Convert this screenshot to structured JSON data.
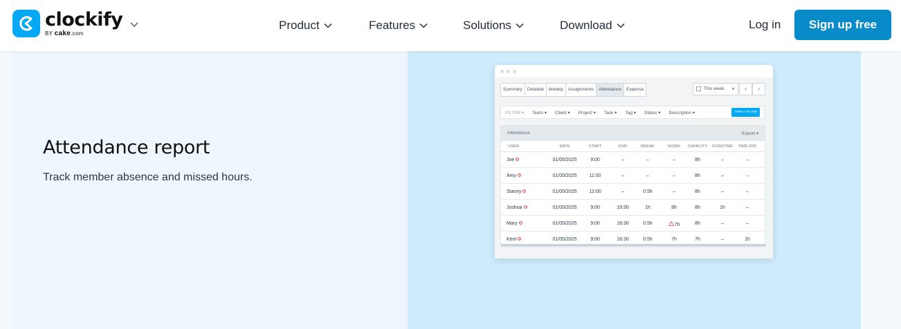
{
  "brand": {
    "name": "clockify",
    "by_prefix": "BY",
    "by_company": "cake",
    "by_suffix": ".com",
    "accent": "#03a9f4"
  },
  "nav": {
    "items": [
      {
        "label": "Product"
      },
      {
        "label": "Features"
      },
      {
        "label": "Solutions"
      },
      {
        "label": "Download"
      }
    ],
    "login": "Log in",
    "signup": "Sign up free",
    "signup_color": "#0a8bc9"
  },
  "feature": {
    "title": "Attendance report",
    "description": "Track member absence and missed hours."
  },
  "mock": {
    "tabs": [
      {
        "label": "Summary",
        "active": false
      },
      {
        "label": "Detailed",
        "active": false
      },
      {
        "label": "Weekly",
        "active": false
      },
      {
        "label": "Assignments",
        "active": false
      },
      {
        "label": "Attendance",
        "active": true
      },
      {
        "label": "Expense",
        "active": false
      }
    ],
    "range": "This week",
    "filters": [
      "FILTER",
      "Team",
      "Client",
      "Project",
      "Task",
      "Tag",
      "Status",
      "Description"
    ],
    "apply_label": "APPLY FILTER",
    "table_title": "Attendance",
    "export_label": "Export",
    "columns": [
      "USER",
      "DATE",
      "START",
      "END",
      "BREAK",
      "WORK",
      "CAPACITY",
      "OVERTIME",
      "TIME OFF"
    ],
    "rows": [
      {
        "user": "Joe",
        "date": "01/05/2025",
        "start": "9:00",
        "end": "–",
        "break": "–",
        "work": "–",
        "capacity": "8h",
        "overtime": "–",
        "timeoff": "–",
        "warn": false
      },
      {
        "user": "Amy",
        "date": "01/05/2025",
        "start": "11:00",
        "end": "–",
        "break": "–",
        "work": "–",
        "capacity": "8h",
        "overtime": "–",
        "timeoff": "–",
        "warn": false
      },
      {
        "user": "Stacey",
        "date": "01/05/2025",
        "start": "12:00",
        "end": "–",
        "break": "0.5h",
        "work": "–",
        "capacity": "8h",
        "overtime": "–",
        "timeoff": "–",
        "warn": false
      },
      {
        "user": "Joshua",
        "date": "01/05/2025",
        "start": "9:00",
        "end": "19:30",
        "break": "1h",
        "work": "9h",
        "capacity": "8h",
        "overtime": "1h",
        "timeoff": "–",
        "warn": false
      },
      {
        "user": "Mary",
        "date": "01/05/2025",
        "start": "9:00",
        "end": "16:30",
        "break": "0.5h",
        "work": "7h",
        "capacity": "8h",
        "overtime": "–",
        "timeoff": "–",
        "warn": true
      },
      {
        "user": "Kent",
        "date": "01/05/2025",
        "start": "9:00",
        "end": "16:30",
        "break": "0.5h",
        "work": "7h",
        "capacity": "7h",
        "overtime": "–",
        "timeoff": "1h",
        "warn": false
      }
    ]
  }
}
